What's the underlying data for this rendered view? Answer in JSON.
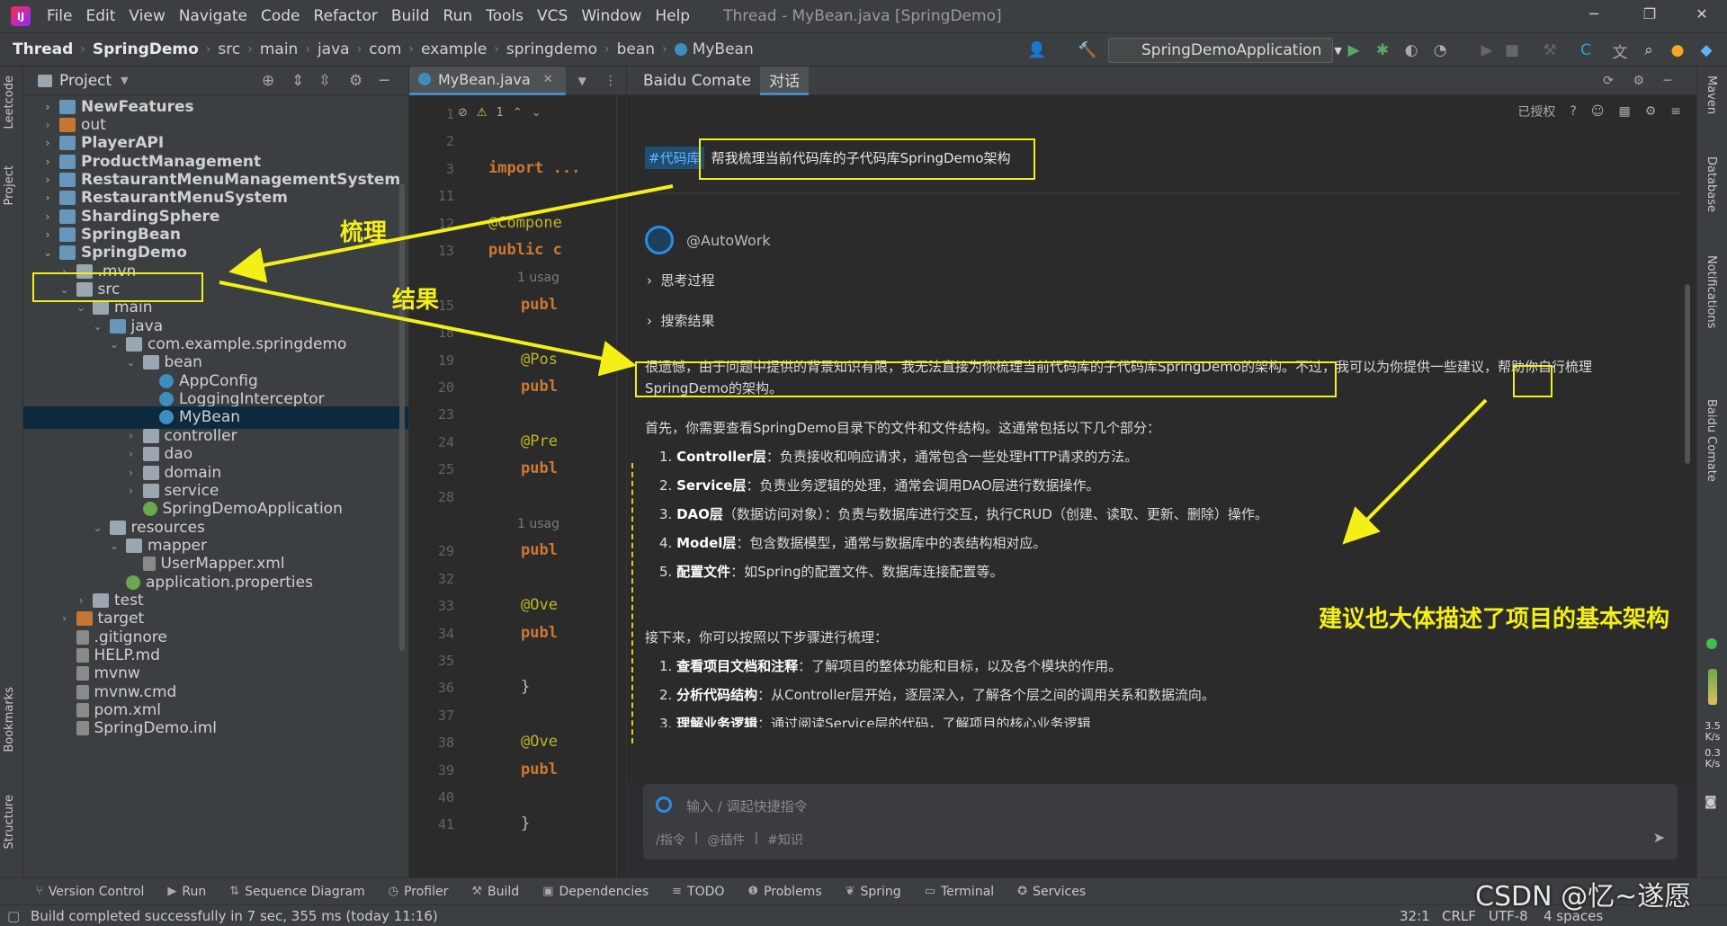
{
  "app": {
    "menu": [
      "File",
      "Edit",
      "View",
      "Navigate",
      "Code",
      "Refactor",
      "Build",
      "Run",
      "Tools",
      "VCS",
      "Window",
      "Help"
    ],
    "window_title": "Thread - MyBean.java [SpringDemo]"
  },
  "breadcrumb": [
    "Thread",
    "SpringDemo",
    "src",
    "main",
    "java",
    "com",
    "example",
    "springdemo",
    "bean",
    "MyBean"
  ],
  "run_config": "SpringDemoApplication",
  "project_panel": {
    "title": "Project",
    "tree": [
      {
        "label": "NewFeatures",
        "depth": 0,
        "icon": "module",
        "bold": true,
        "arrow": "collapsed"
      },
      {
        "label": "out",
        "depth": 0,
        "icon": "orange",
        "bold": false,
        "arrow": "collapsed"
      },
      {
        "label": "PlayerAPI",
        "depth": 0,
        "icon": "module",
        "bold": true,
        "arrow": "collapsed"
      },
      {
        "label": "ProductManagement",
        "depth": 0,
        "icon": "module",
        "bold": true,
        "arrow": "collapsed"
      },
      {
        "label": "RestaurantMenuManagementSystem",
        "depth": 0,
        "icon": "module",
        "bold": true,
        "arrow": "collapsed"
      },
      {
        "label": "RestaurantMenuSystem",
        "depth": 0,
        "icon": "module",
        "bold": true,
        "arrow": "collapsed"
      },
      {
        "label": "ShardingSphere",
        "depth": 0,
        "icon": "module",
        "bold": true,
        "arrow": "collapsed"
      },
      {
        "label": "SpringBean",
        "depth": 0,
        "icon": "module",
        "bold": true,
        "arrow": "collapsed"
      },
      {
        "label": "SpringDemo",
        "depth": 0,
        "icon": "module",
        "bold": true,
        "arrow": "expanded"
      },
      {
        "label": ".mvn",
        "depth": 1,
        "icon": "folder",
        "bold": false,
        "arrow": "collapsed"
      },
      {
        "label": "src",
        "depth": 1,
        "icon": "folder",
        "bold": false,
        "arrow": "expanded"
      },
      {
        "label": "main",
        "depth": 2,
        "icon": "folder",
        "bold": false,
        "arrow": "expanded"
      },
      {
        "label": "java",
        "depth": 3,
        "icon": "module",
        "bold": false,
        "arrow": "expanded"
      },
      {
        "label": "com.example.springdemo",
        "depth": 4,
        "icon": "folder",
        "bold": false,
        "arrow": "expanded"
      },
      {
        "label": "bean",
        "depth": 5,
        "icon": "folder",
        "bold": false,
        "arrow": "expanded"
      },
      {
        "label": "AppConfig",
        "depth": 6,
        "icon": "class",
        "bold": false,
        "arrow": "none"
      },
      {
        "label": "LoggingInterceptor",
        "depth": 6,
        "icon": "class",
        "bold": false,
        "arrow": "none"
      },
      {
        "label": "MyBean",
        "depth": 6,
        "icon": "class",
        "bold": false,
        "arrow": "none",
        "selected": true
      },
      {
        "label": "controller",
        "depth": 5,
        "icon": "folder",
        "bold": false,
        "arrow": "collapsed"
      },
      {
        "label": "dao",
        "depth": 5,
        "icon": "folder",
        "bold": false,
        "arrow": "collapsed"
      },
      {
        "label": "domain",
        "depth": 5,
        "icon": "folder",
        "bold": false,
        "arrow": "collapsed"
      },
      {
        "label": "service",
        "depth": 5,
        "icon": "folder",
        "bold": false,
        "arrow": "collapsed"
      },
      {
        "label": "SpringDemoApplication",
        "depth": 5,
        "icon": "spring",
        "bold": false,
        "arrow": "none"
      },
      {
        "label": "resources",
        "depth": 3,
        "icon": "folder",
        "bold": false,
        "arrow": "expanded"
      },
      {
        "label": "mapper",
        "depth": 4,
        "icon": "folder",
        "bold": false,
        "arrow": "expanded"
      },
      {
        "label": "UserMapper.xml",
        "depth": 5,
        "icon": "file",
        "bold": false,
        "arrow": "none"
      },
      {
        "label": "application.properties",
        "depth": 4,
        "icon": "spring",
        "bold": false,
        "arrow": "none"
      },
      {
        "label": "test",
        "depth": 2,
        "icon": "folder",
        "bold": false,
        "arrow": "collapsed"
      },
      {
        "label": "target",
        "depth": 1,
        "icon": "orange",
        "bold": false,
        "arrow": "collapsed"
      },
      {
        "label": ".gitignore",
        "depth": 1,
        "icon": "file",
        "bold": false,
        "arrow": "none"
      },
      {
        "label": "HELP.md",
        "depth": 1,
        "icon": "file",
        "bold": false,
        "arrow": "none"
      },
      {
        "label": "mvnw",
        "depth": 1,
        "icon": "file",
        "bold": false,
        "arrow": "none"
      },
      {
        "label": "mvnw.cmd",
        "depth": 1,
        "icon": "file",
        "bold": false,
        "arrow": "none"
      },
      {
        "label": "pom.xml",
        "depth": 1,
        "icon": "file",
        "bold": false,
        "arrow": "none"
      },
      {
        "label": "SpringDemo.iml",
        "depth": 1,
        "icon": "file",
        "bold": false,
        "arrow": "none"
      }
    ]
  },
  "editor": {
    "tab": "MyBean.java",
    "warning_count": "1",
    "line_numbers": [
      "1",
      "2",
      "3",
      "11",
      "12",
      "13",
      "",
      "15",
      "18",
      "19",
      "20",
      "23",
      "24",
      "25",
      "28",
      "",
      "29",
      "32",
      "33",
      "34",
      "35",
      "36",
      "37",
      "38",
      "39",
      "40",
      "41"
    ],
    "lines": [
      {
        "text": "",
        "cls": ""
      },
      {
        "text": "",
        "cls": ""
      },
      {
        "text": "import ...",
        "cls": "kw"
      },
      {
        "text": "",
        "cls": ""
      },
      {
        "text": "@Compone",
        "cls": "ann"
      },
      {
        "text": "public c",
        "cls": "kw"
      },
      {
        "text": "1 usag",
        "cls": "hint"
      },
      {
        "text": "publ",
        "cls": "kw"
      },
      {
        "text": "",
        "cls": ""
      },
      {
        "text": "@Pos",
        "cls": "ann"
      },
      {
        "text": "publ",
        "cls": "kw"
      },
      {
        "text": "",
        "cls": ""
      },
      {
        "text": "@Pre",
        "cls": "ann"
      },
      {
        "text": "publ",
        "cls": "kw"
      },
      {
        "text": "",
        "cls": ""
      },
      {
        "text": "1 usag",
        "cls": "hint"
      },
      {
        "text": "publ",
        "cls": "kw"
      },
      {
        "text": "",
        "cls": ""
      },
      {
        "text": "@Ove",
        "cls": "ann"
      },
      {
        "text": "publ",
        "cls": "kw"
      },
      {
        "text": "",
        "cls": ""
      },
      {
        "text": "}",
        "cls": ""
      },
      {
        "text": "",
        "cls": ""
      },
      {
        "text": "@Ove",
        "cls": "ann"
      },
      {
        "text": "publ",
        "cls": "kw"
      },
      {
        "text": "",
        "cls": ""
      },
      {
        "text": "}",
        "cls": ""
      }
    ]
  },
  "comate": {
    "tabs": [
      "Baidu Comate",
      "对话"
    ],
    "authorized": "已授权",
    "user_tag": "#代码库",
    "user_query": "帮我梳理当前代码库的子代码库SpringDemo架构",
    "bot_name": "@AutoWork",
    "collapse_1": "思考过程",
    "collapse_2": "搜索结果",
    "answer_intro_1": "很遗憾，由于问题中提供的背景知识有限，我无法直接为你梳理当前代码库的子代码库SpringDemo的架构。",
    "answer_intro_2": "不过，我可以为你提供一些",
    "answer_intro_keyword": "建议",
    "answer_intro_3": "，帮助你自行梳理",
    "answer_intro_4": "SpringDemo的架构。",
    "first_line": "首先，你需要查看SpringDemo目录下的文件和文件结构。这通常包括以下几个部分：",
    "layers": [
      {
        "num": "1.",
        "title": "Controller层",
        "desc": "：负责接收和响应请求，通常包含一些处理HTTP请求的方法。"
      },
      {
        "num": "2.",
        "title": "Service层",
        "desc": "：负责业务逻辑的处理，通常会调用DAO层进行数据操作。"
      },
      {
        "num": "3.",
        "title": "DAO层",
        "desc": "（数据访问对象）：负责与数据库进行交互，执行CRUD（创建、读取、更新、删除）操作。"
      },
      {
        "num": "4.",
        "title": "Model层",
        "desc": "：包含数据模型，通常与数据库中的表结构相对应。"
      },
      {
        "num": "5.",
        "title": "配置文件",
        "desc": "：如Spring的配置文件、数据库连接配置等。"
      }
    ],
    "next_line": "接下来，你可以按照以下步骤进行梳理：",
    "steps": [
      {
        "num": "1.",
        "title": "查看项目文档和注释",
        "desc": "：了解项目的整体功能和目标，以及各个模块的作用。"
      },
      {
        "num": "2.",
        "title": "分析代码结构",
        "desc": "：从Controller层开始，逐层深入，了解各个层之间的调用关系和数据流向。"
      },
      {
        "num": "3.",
        "title": "理解业务逻辑",
        "desc": "：通过阅读Service层的代码，了解项目的核心业务逻辑"
      }
    ],
    "input_placeholder": "输入 / 调起快捷指令",
    "input_hints": [
      "/指令",
      "@插件",
      "#知识"
    ]
  },
  "left_stripe": [
    "Leetcode",
    "Project",
    "Bookmarks",
    "Structure"
  ],
  "right_stripe": [
    "Maven",
    "Database",
    "Notifications",
    "Baidu Comate"
  ],
  "net_speed": {
    "up": "3.5",
    "up_unit": "K/s",
    "down": "0.3",
    "down_unit": "K/s"
  },
  "bottom_tools": [
    "Version Control",
    "Run",
    "Sequence Diagram",
    "Profiler",
    "Build",
    "Dependencies",
    "TODO",
    "Problems",
    "Spring",
    "Terminal",
    "Services"
  ],
  "status": {
    "message": "Build completed successfully in 7 sec, 355 ms (today 11:16)",
    "position": "32:1",
    "line_sep": "CRLF",
    "encoding": "UTF-8",
    "indent": "4 spaces"
  },
  "watermark": "CSDN @忆~遂愿",
  "annotations": {
    "label_sort": "梳理",
    "label_result": "结果",
    "label_suggest": "建议也大体描述了项目的基本架构",
    "color": "#f4ef16"
  }
}
